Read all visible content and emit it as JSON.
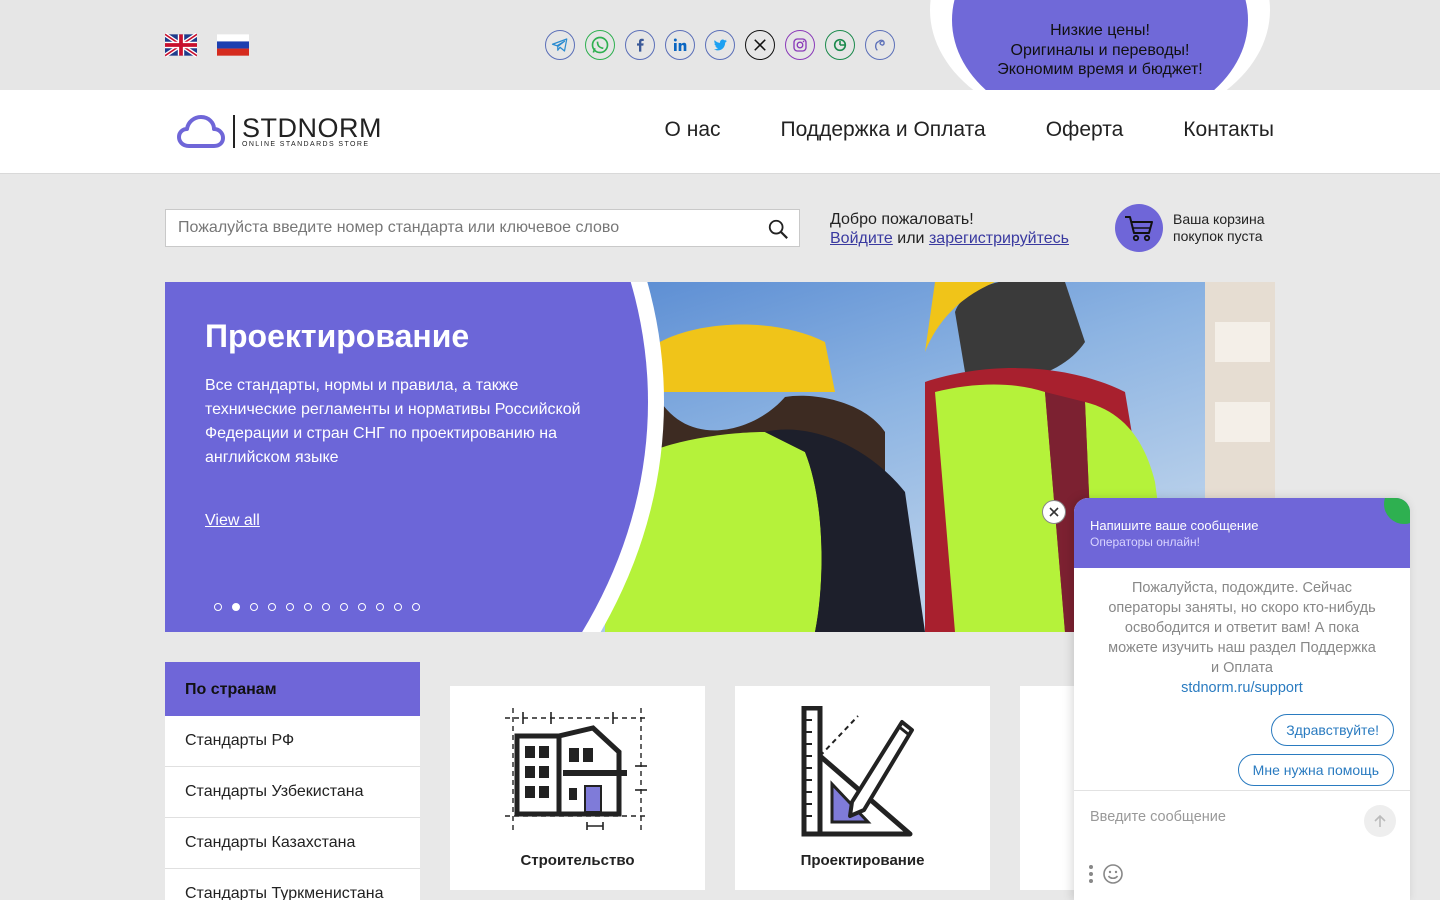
{
  "topbar": {
    "languages": [
      {
        "name": "English",
        "icon": "uk-flag-icon"
      },
      {
        "name": "Русский",
        "icon": "ru-flag-icon"
      }
    ],
    "socials": [
      "telegram-icon",
      "whatsapp-icon",
      "facebook-icon",
      "linkedin-icon",
      "twitter-icon",
      "x-icon",
      "instagram-icon",
      "livejournal-icon",
      "vk-icon"
    ],
    "promo": {
      "line1": "Низкие цены!",
      "line2": "Оригиналы и переводы!",
      "line3": "Экономим время и бюджет!"
    }
  },
  "header": {
    "logo_name": "STDNORM",
    "logo_sub": "ONLINE STANDARDS STORE",
    "nav": [
      "О нас",
      "Поддержка и Оплата",
      "Оферта",
      "Контакты"
    ]
  },
  "search": {
    "placeholder": "Пожалуйста введите номер стандарта или ключевое слово"
  },
  "account": {
    "welcome": "Добро пожаловать!",
    "login": "Войдите",
    "or": "или",
    "register": "зарегистрируйтесь"
  },
  "cart": {
    "line1": "Ваша корзина",
    "line2": "покупок пуста"
  },
  "hero": {
    "title": "Проектирование",
    "description": "Все стандарты, нормы и правила, а также технические регламенты и нормативы Российской Федерации и стран СНГ по проектированию на английском языке",
    "link": "View all",
    "slide_count": 12,
    "active_slide": 2
  },
  "sidebar": {
    "title": "По странам",
    "items": [
      "Стандарты РФ",
      "Стандарты Узбекистана",
      "Стандарты Казахстана",
      "Стандарты Туркменистана"
    ]
  },
  "categories": [
    {
      "label": "Строительство",
      "icon": "building-icon"
    },
    {
      "label": "Проектирование",
      "icon": "drafting-tools-icon"
    }
  ],
  "chat": {
    "title": "Напишите ваше сообщение",
    "status": "Операторы онлайн!",
    "message": "Пожалуйста, подождите. Сейчас операторы заняты, но скоро кто-нибудь освободится и ответит вам! А пока можете изучить наш раздел Поддержка и Оплата",
    "link": "stdnorm.ru/support",
    "quick_replies": [
      "Здравствуйте!",
      "Мне нужна помощь"
    ],
    "input_placeholder": "Введите сообщение"
  },
  "colors": {
    "accent": "#6f66d8",
    "link": "#2a7bc0",
    "online": "#2eb050"
  }
}
